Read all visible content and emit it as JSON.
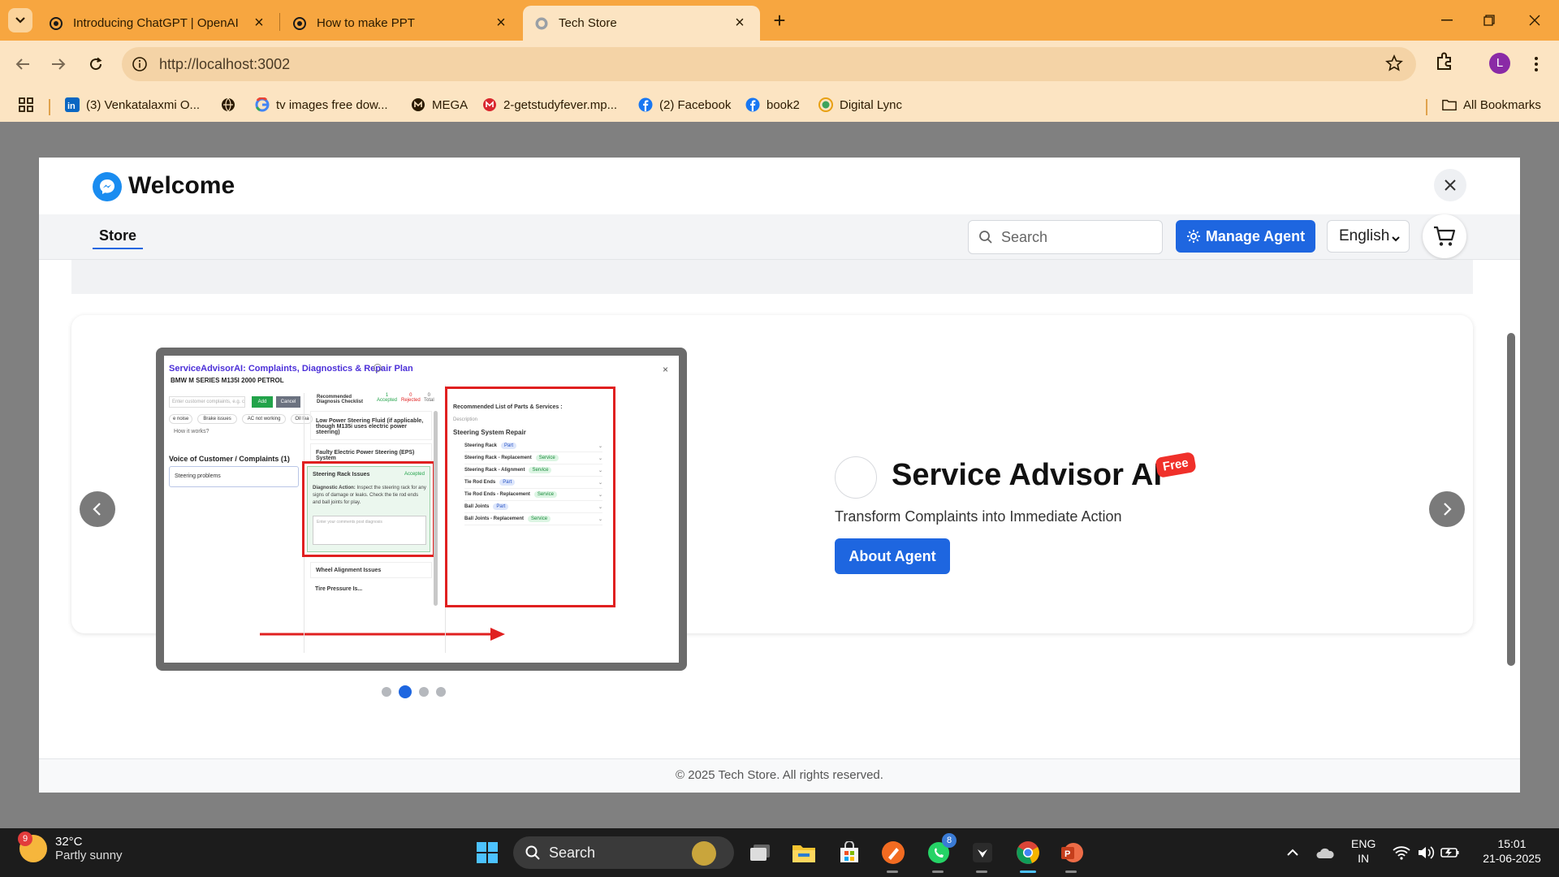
{
  "browser": {
    "tabs": [
      {
        "title": "Introducing ChatGPT | OpenAI",
        "active": false
      },
      {
        "title": "How to make PPT",
        "active": false
      },
      {
        "title": "Tech Store",
        "active": true
      }
    ],
    "url": "http://localhost:3002",
    "profile_initial": "L",
    "bookmarks": [
      {
        "label": "(3) Venkatalaxmi O...",
        "icon": "linkedin-icon"
      },
      {
        "label": "",
        "icon": "globe-icon"
      },
      {
        "label": "tv images free dow...",
        "icon": "google-icon"
      },
      {
        "label": "MEGA",
        "icon": "mega-icon"
      },
      {
        "label": "2-getstudyfever.mp...",
        "icon": "mega-red-icon"
      },
      {
        "label": "(2) Facebook",
        "icon": "facebook-icon"
      },
      {
        "label": "book2",
        "icon": "facebook-icon"
      },
      {
        "label": "Digital Lync",
        "icon": "digital-lync-icon"
      }
    ],
    "all_bookmarks": "All Bookmarks"
  },
  "app": {
    "title": "Welcome",
    "store_tab": "Store",
    "search_placeholder": "Search",
    "manage_agent": "Manage Agent",
    "language": "English",
    "agent": {
      "title": "Service Advisor AI",
      "badge": "Free",
      "subtitle": "Transform Complaints into Immediate Action",
      "about_button": "About Agent"
    },
    "carousel": {
      "slides": 4,
      "active_index": 1
    },
    "footer": "© 2025 Tech Store. All rights reserved."
  },
  "slide_shot": {
    "title": "ServiceAdvisorAI: Complaints, Diagnostics & Repair Plan",
    "vehicle": "BMW M SERIES M135I 2000 PETROL",
    "input_placeholder": "Enter customer complaints, e.g. compl",
    "add": "Add",
    "cancel": "Cancel",
    "chips": [
      "e noise",
      "Brake issues",
      "AC not working",
      "Oil lea"
    ],
    "how": "How it works?",
    "voc_title": "Voice of Customer / Complaints (1)",
    "voc_item": "Steering problems",
    "checklist_title": "Recommended Diagnosis Checklist",
    "stats": [
      {
        "value": "1",
        "label": "Accepted"
      },
      {
        "value": "0",
        "label": "Rejected"
      },
      {
        "value": "0",
        "label": "Total"
      }
    ],
    "checks": [
      "Low Power Steering Fluid (if applicable, though M135i uses electric power steering)",
      "Faulty Electric Power Steering (EPS) System"
    ],
    "accepted_card": {
      "title": "Steering Rack Issues",
      "status": "Accepted",
      "label": "Diagnostic Action:",
      "text": "Inspect the steering rack for any signs of damage or leaks. Check the tie rod ends and ball joints for play.",
      "comment_placeholder": "Enter your comments post diagnosis"
    },
    "more_checks": [
      "Wheel Alignment Issues",
      "Tire Pressure Is..."
    ],
    "parts_title": "Recommended List of Parts & Services :",
    "parts_desc": "Description",
    "parts_group": "Steering System Repair",
    "parts": [
      {
        "name": "Steering Rack",
        "tag": "Part"
      },
      {
        "name": "Steering Rack - Replacement",
        "tag": "Service"
      },
      {
        "name": "Steering Rack - Alignment",
        "tag": "Service"
      },
      {
        "name": "Tie Rod Ends",
        "tag": "Part"
      },
      {
        "name": "Tie Rod Ends - Replacement",
        "tag": "Service"
      },
      {
        "name": "Ball Joints",
        "tag": "Part"
      },
      {
        "name": "Ball Joints - Replacement",
        "tag": "Service"
      }
    ]
  },
  "taskbar": {
    "temp": "32°C",
    "weather": "Partly sunny",
    "weather_badge": "9",
    "search": "Search",
    "whatsapp_badge": "8",
    "lang_top": "ENG",
    "lang_bottom": "IN",
    "time": "15:01",
    "date": "21-06-2025"
  },
  "colors": {
    "tabbar": "#f7a640",
    "toolbar": "#fce4c2",
    "accent": "#1e66e0",
    "badge": "#f0302a"
  }
}
